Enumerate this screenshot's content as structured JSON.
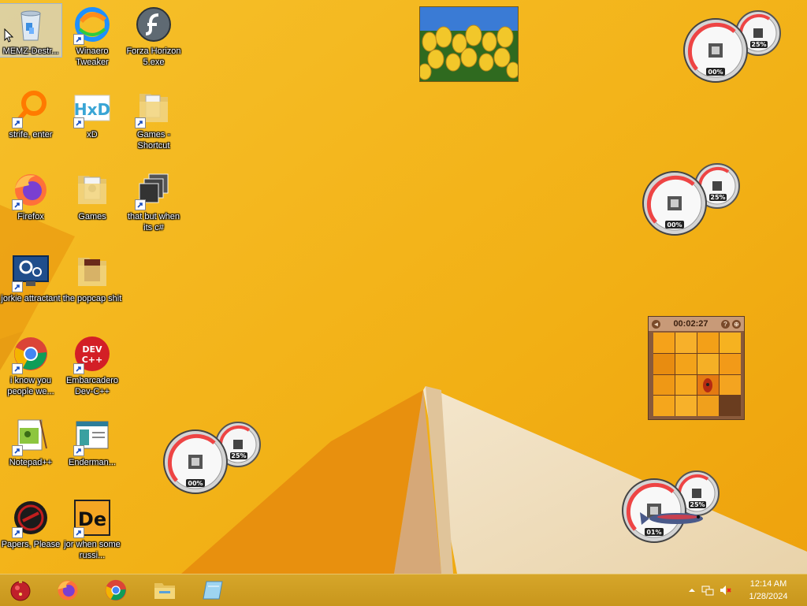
{
  "desktop": {
    "icons": [
      {
        "label": "MEMZ-Destr...",
        "icon": "recycle-bin-icon",
        "shortcut": false
      },
      {
        "label": "Winaero Tweaker",
        "icon": "winaero-icon",
        "shortcut": true
      },
      {
        "label": "Forza Horizon 5.exe",
        "icon": "flash-icon",
        "shortcut": true
      },
      {
        "label": "strife, enter",
        "icon": "magnifier-icon",
        "shortcut": true
      },
      {
        "label": "xD",
        "icon": "hxd-icon",
        "shortcut": true
      },
      {
        "label": "Games - Shortcut",
        "icon": "folder-icon",
        "shortcut": true
      },
      {
        "label": "Firefox",
        "icon": "firefox-icon",
        "shortcut": true
      },
      {
        "label": "Games",
        "icon": "folder-icon",
        "shortcut": false
      },
      {
        "label": "that but when its c#",
        "icon": "stacked-windows-icon",
        "shortcut": true
      },
      {
        "label": "jorkie attractant",
        "icon": "settings-monitor-icon",
        "shortcut": true
      },
      {
        "label": "the popcap shit",
        "icon": "folder-icon",
        "shortcut": false
      },
      {
        "label": "i know you people we...",
        "icon": "chrome-icon",
        "shortcut": true
      },
      {
        "label": "Embarcadero Dev-C++",
        "icon": "devcpp-icon",
        "shortcut": true
      },
      {
        "label": "Notepad++",
        "icon": "notepadpp-icon",
        "shortcut": true
      },
      {
        "label": "Enderman...",
        "icon": "window-app-icon",
        "shortcut": true
      },
      {
        "label": "Papers, Please",
        "icon": "papers-please-icon",
        "shortcut": true
      },
      {
        "label": "jor when some russi...",
        "icon": "de-icon",
        "shortcut": true
      }
    ],
    "devcpp_text": "DEV C++",
    "hxd_text": "HxD",
    "de_text": "De"
  },
  "gadgets": {
    "meters": [
      {
        "cpu": "00%",
        "memory": "25%",
        "cpu_value": 0,
        "memory_value": 25
      },
      {
        "cpu": "00%",
        "memory": "25%",
        "cpu_value": 0,
        "memory_value": 25
      },
      {
        "cpu": "00%",
        "memory": "25%",
        "cpu_value": 0,
        "memory_value": 25
      },
      {
        "cpu": "01%",
        "memory": "25%",
        "cpu_value": 1,
        "memory_value": 25
      }
    ],
    "puzzle": {
      "time": "00:02:27",
      "help": "?",
      "menu": "⊕",
      "back": "◄"
    }
  },
  "taskbar": {
    "pinned": [
      "start-orb-icon",
      "firefox-icon",
      "chrome-icon",
      "file-explorer-icon",
      "app-icon"
    ],
    "clock_time": "12:14 AM",
    "clock_date": "1/28/2024",
    "tray_icons": [
      "show-hidden-icons-icon",
      "network-icon",
      "volume-muted-icon"
    ]
  },
  "colors": {
    "wallpaper_orange": "#f3b316",
    "taskbar": "#c8961c"
  }
}
